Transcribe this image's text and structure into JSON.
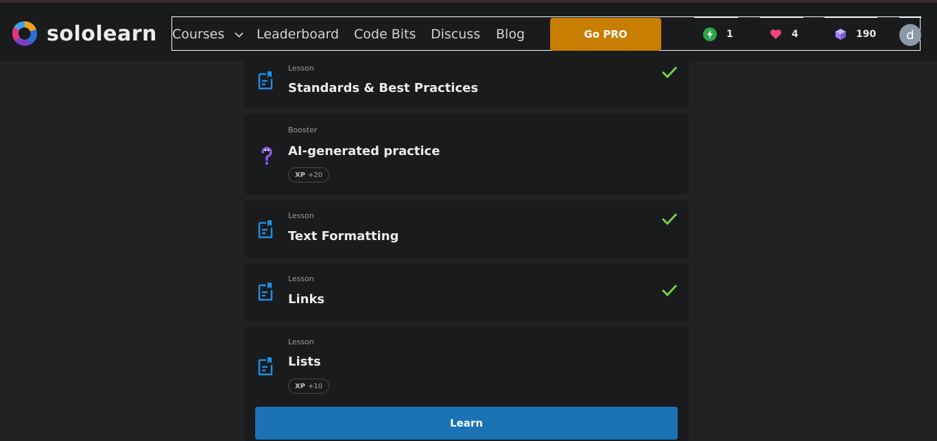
{
  "brand": {
    "name": "sololearn",
    "colors": {
      "pink": "#e8357a",
      "orange": "#f0a020",
      "blue": "#2a6fd6",
      "purple": "#7b3fc4"
    }
  },
  "nav": {
    "courses_label": "Courses",
    "leaderboard_label": "Leaderboard",
    "codebits_label": "Code Bits",
    "discuss_label": "Discuss",
    "blog_label": "Blog",
    "go_pro_label": "Go PRO"
  },
  "stats": {
    "streak": {
      "value": "1",
      "icon": "lightning-icon",
      "color": "#2fa34a"
    },
    "hearts": {
      "value": "4",
      "icon": "heart-icon",
      "color": "#f0457f"
    },
    "gems": {
      "value": "190",
      "icon": "gem-icon",
      "color": "#9b7ef5"
    }
  },
  "user": {
    "avatar_letter": "d",
    "avatar_color": "#8b9aa6"
  },
  "lessons": [
    {
      "type": "Lesson",
      "title": "Standards & Best Practices",
      "completed": true,
      "icon": "lesson-doc-icon"
    },
    {
      "type": "Booster",
      "title": "AI-generated practice",
      "completed": false,
      "icon": "question-mark-icon",
      "xp_label": "XP",
      "xp_value": "+20"
    },
    {
      "type": "Lesson",
      "title": "Text Formatting",
      "completed": true,
      "icon": "lesson-doc-icon"
    },
    {
      "type": "Lesson",
      "title": "Links",
      "completed": true,
      "icon": "lesson-doc-icon"
    },
    {
      "type": "Lesson",
      "title": "Lists",
      "completed": false,
      "icon": "lesson-doc-icon",
      "xp_label": "XP",
      "xp_value": "+10"
    }
  ],
  "learn_button_label": "Learn",
  "accent": {
    "check": "#7ad34a",
    "lesson_icon": "#1e90e8",
    "learn_button": "#1b73b5",
    "go_pro": "#c87e00"
  }
}
